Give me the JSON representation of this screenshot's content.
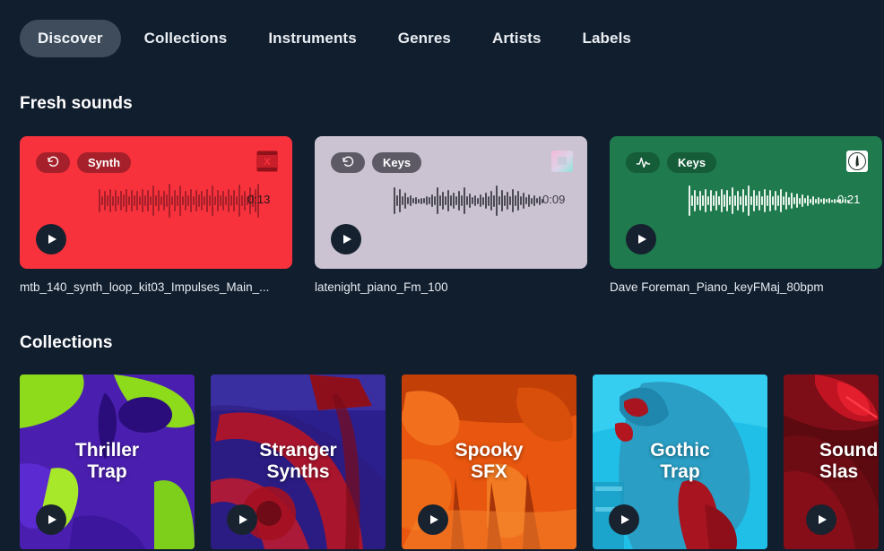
{
  "nav": {
    "tabs": [
      {
        "label": "Discover",
        "active": true
      },
      {
        "label": "Collections",
        "active": false
      },
      {
        "label": "Instruments",
        "active": false
      },
      {
        "label": "Genres",
        "active": false
      },
      {
        "label": "Artists",
        "active": false
      },
      {
        "label": "Labels",
        "active": false
      }
    ]
  },
  "fresh_sounds": {
    "heading": "Fresh sounds",
    "cards": [
      {
        "title": "mtb_140_synth_loop_kit03_Impulses_Main_...",
        "duration": "0:13",
        "tag_icon": "loop-icon",
        "tag_label": "Synth",
        "bg": "#f8323c",
        "thumb": "album-art-red-x"
      },
      {
        "title": "latenight_piano_Fm_100",
        "duration": "0:09",
        "tag_icon": "loop-icon",
        "tag_label": "Keys",
        "bg": "#cbc3d2",
        "thumb": "album-art-pastel"
      },
      {
        "title": "Dave Foreman_Piano_keyFMaj_80bpm",
        "duration": "0:21",
        "tag_icon": "waveform-icon",
        "tag_label": "Keys",
        "bg": "#1f7a4d",
        "thumb": "album-art-white-circle"
      }
    ]
  },
  "collections": {
    "heading": "Collections",
    "cards": [
      {
        "title": "Thriller\nTrap",
        "art": "purple-green-face"
      },
      {
        "title": "Stranger\nSynths",
        "art": "blue-red-bike"
      },
      {
        "title": "Spooky\nSFX",
        "art": "orange-pumpkin"
      },
      {
        "title": "Gothic\nTrap",
        "art": "cyan-red-gargoyle"
      },
      {
        "title": "Sound\nSlas",
        "art": "dark-red-hands"
      }
    ]
  },
  "colors": {
    "background": "#111e2e",
    "active_tab": "#3e4c5c",
    "text": "#ffffff"
  }
}
